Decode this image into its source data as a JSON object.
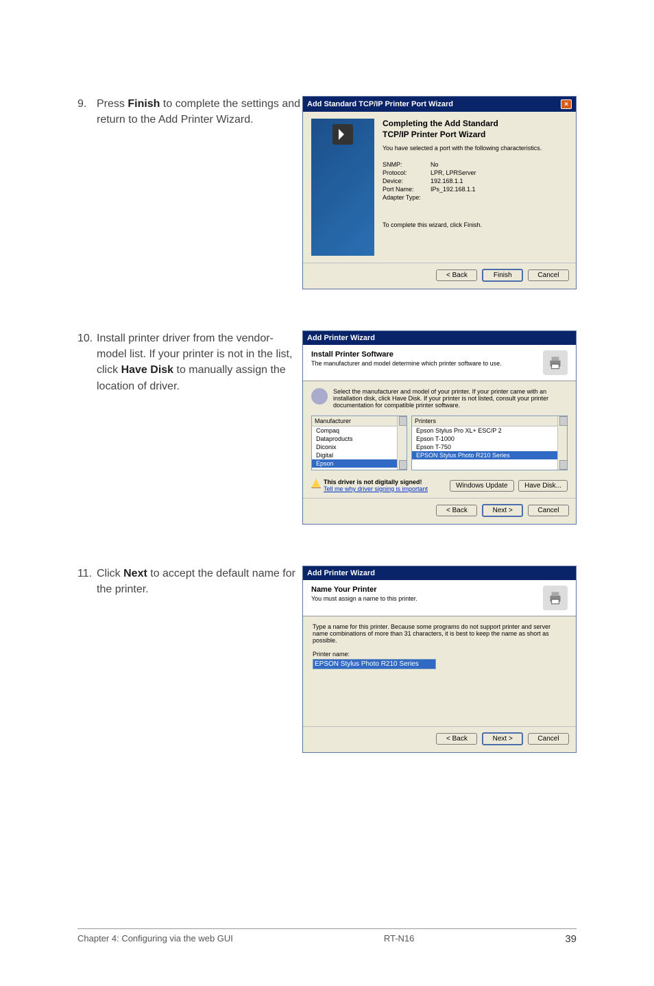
{
  "steps": {
    "s9": {
      "num": "9.",
      "text_before": "Press ",
      "bold": "Finish",
      "text_after": " to complete the settings and return to the Add Printer Wizard."
    },
    "s10": {
      "num": "10.",
      "text_a": "Install printer driver from the vendor-model list. If your printer is not in the list, click ",
      "bold": "Have Disk",
      "text_b": " to manually assign the location of driver."
    },
    "s11": {
      "num": "11.",
      "text_a": "Click ",
      "bold": "Next",
      "text_b": " to accept the default name for the printer."
    }
  },
  "dlg1": {
    "title": "Add Standard TCP/IP Printer Port Wizard",
    "heading1": "Completing the Add Standard",
    "heading2": "TCP/IP Printer Port Wizard",
    "sub": "You have selected a port with the following characteristics.",
    "rows": {
      "snmp_k": "SNMP:",
      "snmp_v": "No",
      "proto_k": "Protocol:",
      "proto_v": "LPR, LPRServer",
      "dev_k": "Device:",
      "dev_v": "192.168.1.1",
      "port_k": "Port Name:",
      "port_v": "IPs_192.168.1.1",
      "adapt_k": "Adapter Type:",
      "adapt_v": ""
    },
    "finish_note": "To complete this wizard, click Finish.",
    "back": "< Back",
    "finish": "Finish",
    "cancel": "Cancel"
  },
  "dlg2": {
    "title": "Add Printer Wizard",
    "head": "Install Printer Software",
    "head_sub": "The manufacturer and model determine which printer software to use.",
    "info": "Select the manufacturer and model of your printer. If your printer came with an installation disk, click Have Disk. If your printer is not listed, consult your printer documentation for compatible printer software.",
    "mfr_hdr": "Manufacturer",
    "prn_hdr": "Printers",
    "mfrs": [
      "Compaq",
      "Dataproducts",
      "Diconix",
      "Digital",
      "Epson"
    ],
    "prns": [
      "Epson Stylus Pro XL+ ESC/P 2",
      "Epson T-1000",
      "Epson T-750",
      "EPSON Stylus Photo R210 Series"
    ],
    "warn": "This driver is not digitally signed!",
    "warn_link": "Tell me why driver signing is important",
    "wu": "Windows Update",
    "hd": "Have Disk...",
    "back": "< Back",
    "next": "Next >",
    "cancel": "Cancel"
  },
  "dlg3": {
    "title": "Add Printer Wizard",
    "head": "Name Your Printer",
    "head_sub": "You must assign a name to this printer.",
    "info": "Type a name for this printer. Because some programs do not support printer and server name combinations of more than 31 characters, it is best to keep the name as short as possible.",
    "label": "Printer name:",
    "value": "EPSON Stylus Photo R210 Series",
    "back": "< Back",
    "next": "Next >",
    "cancel": "Cancel"
  },
  "footer": {
    "left": "Chapter 4: Configuring via the web GUI",
    "center": "RT-N16",
    "right": "39"
  }
}
